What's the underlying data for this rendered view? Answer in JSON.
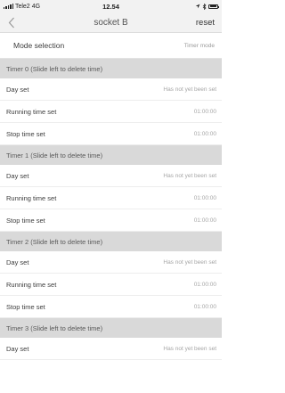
{
  "status": {
    "carrier": "Tele2",
    "network": "4G",
    "time": "12.54"
  },
  "nav": {
    "title": "socket B",
    "reset_label": "reset"
  },
  "mode": {
    "label": "Mode selection",
    "value": "Timer mode"
  },
  "timers": [
    {
      "header": "Timer 0 (Slide left to delete time)",
      "day_label": "Day set",
      "day_value": "Has not yet been set",
      "running_label": "Running time set",
      "running_value": "01:00:00",
      "stop_label": "Stop time set",
      "stop_value": "01:00:00"
    },
    {
      "header": "Timer 1 (Slide left to delete time)",
      "day_label": "Day set",
      "day_value": "Has not yet been set",
      "running_label": "Running time set",
      "running_value": "01:00:00",
      "stop_label": "Stop time set",
      "stop_value": "01:00:00"
    },
    {
      "header": "Timer 2 (Slide left to delete time)",
      "day_label": "Day set",
      "day_value": "Has not yet been set",
      "running_label": "Running time set",
      "running_value": "01:00:00",
      "stop_label": "Stop time set",
      "stop_value": "01:00:00"
    },
    {
      "header": "Timer 3 (Slide left to delete time)",
      "day_label": "Day set",
      "day_value": "Has not yet been set"
    }
  ]
}
